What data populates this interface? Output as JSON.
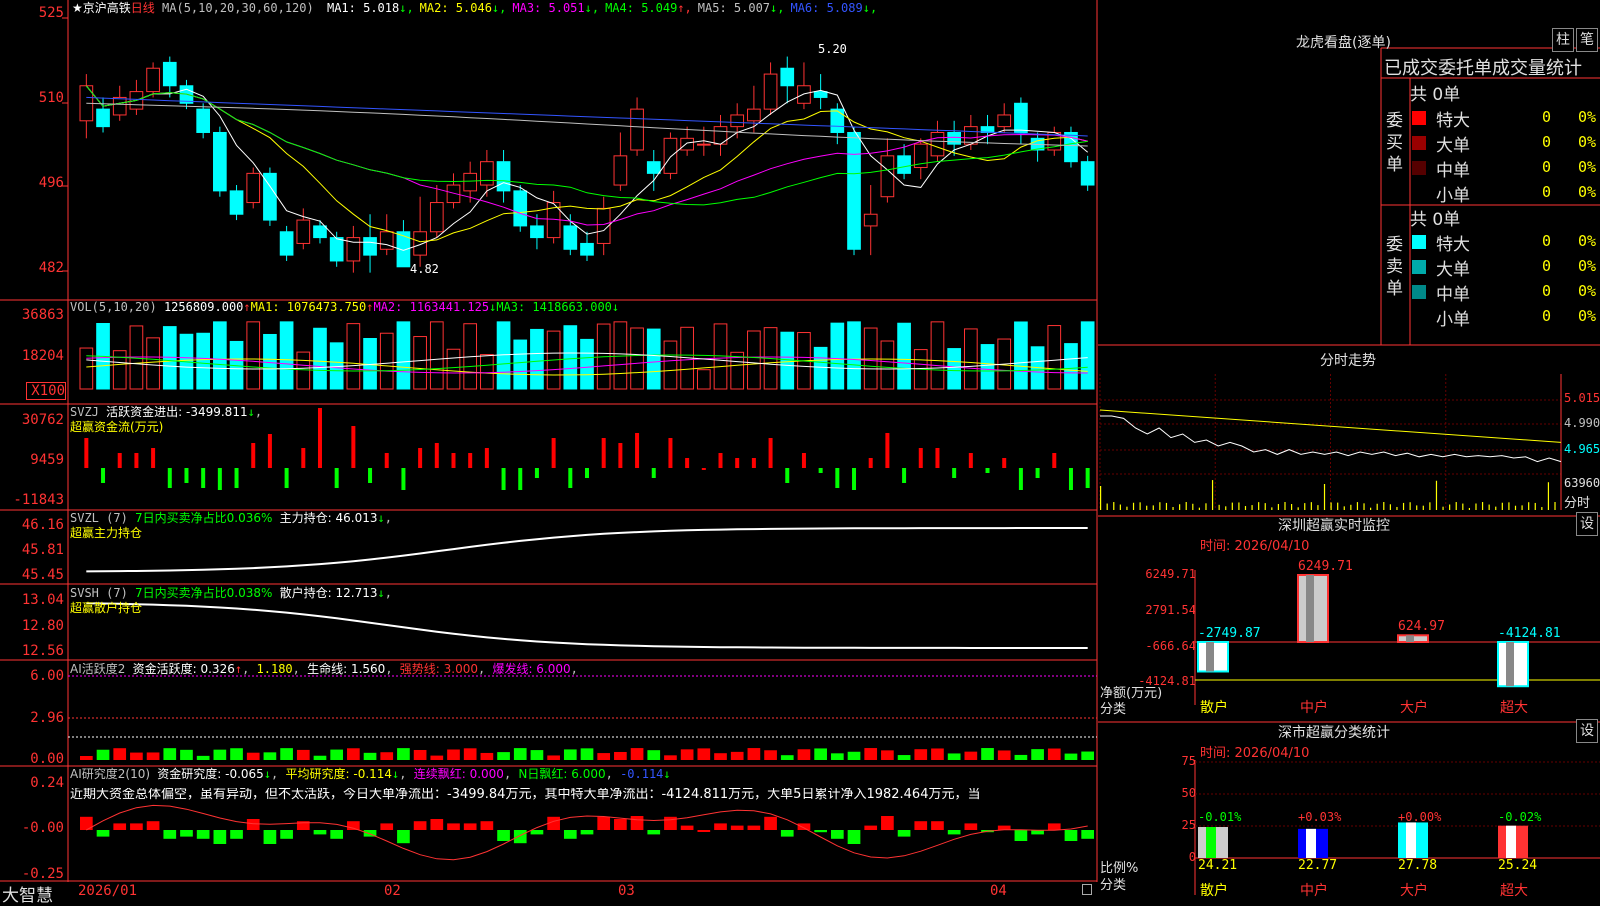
{
  "app": {
    "brand": "大智慧"
  },
  "header": {
    "stock_name": "★京沪高铁",
    "period": "日线",
    "ma_params": "MA(5,10,20,30,60,120)",
    "ma": [
      {
        "label": "MA1: 5.018",
        "arrow": "↓",
        "color": "#ffffff"
      },
      {
        "label": "MA2: 5.046",
        "arrow": "↓",
        "color": "#ffff00"
      },
      {
        "label": "MA3: 5.051",
        "arrow": "↓",
        "color": "#ff00ff"
      },
      {
        "label": "MA4: 5.049",
        "arrow": "↑",
        "color": "#00ff00"
      },
      {
        "label": "MA5: 5.007",
        "arrow": "↓",
        "color": "#c0c0c0"
      },
      {
        "label": "MA6: 5.089",
        "arrow": "↓",
        "color": "#3355ff"
      }
    ]
  },
  "price_panel": {
    "y_ticks": [
      "525",
      "510",
      "496",
      "482"
    ],
    "high_label": "5.20",
    "low_label": "4.82"
  },
  "vol_panel": {
    "title": "VOL(5,10,20)",
    "value": "1256809.000",
    "ma1": "MA1: 1076473.750",
    "ma2": "MA2: 1163441.125",
    "ma3": "MA3: 1418663.000",
    "y_ticks": [
      "36863",
      "18204"
    ],
    "unit": "X100"
  },
  "svzj_panel": {
    "title": "SVZJ",
    "line1": "活跃资金进出: -3499.811",
    "line2": "超赢资金流(万元)",
    "y_ticks": [
      "30762",
      "9459",
      "-11843"
    ]
  },
  "svzl_panel": {
    "title": "SVZL (7)",
    "desc": "7日内买卖净占比0.036%",
    "value": "主力持仓: 46.013",
    "line2": "超赢主力持仓",
    "y_ticks": [
      "46.16",
      "45.81",
      "45.45"
    ]
  },
  "svsh_panel": {
    "title": "SVSH (7)",
    "desc": "7日内买卖净占比0.038%",
    "value": "散户持仓: 12.713",
    "line2": "超赢散户持仓",
    "y_ticks": [
      "13.04",
      "12.80",
      "12.56"
    ]
  },
  "ai1_panel": {
    "title": "AI活跃度2",
    "v1": "资金活跃度: 0.326",
    "v2": "1.180",
    "v3": "生命线: 1.560",
    "v4": "强势线: 3.000",
    "v5": "爆发线: 6.000",
    "y_ticks": [
      "6.00",
      "2.96",
      "0.00"
    ]
  },
  "ai2_panel": {
    "title": "AI研究度2(10)",
    "v1": "资金研究度: -0.065",
    "v2": "平均研究度: -0.114",
    "v3": "连续飘红: 0.000",
    "v4": "N日飘红: 6.000",
    "v5": "-0.114",
    "summary": "近期大资金总体偏空，虽有异动，但不太活跃，今日大单净流出：-3499.84万元，其中特大单净流出：-4124.811万元，大单5日累计净入1982.464万元，当",
    "y_ticks": [
      "0.24",
      "-0.00",
      "-0.25"
    ]
  },
  "x_axis": {
    "labels": [
      "2026/01",
      "02",
      "03",
      "04"
    ]
  },
  "right": {
    "title": "龙虎看盘(逐单)",
    "btn1": "柱",
    "btn2": "笔",
    "tabs": "已成交委托单成交量统计",
    "buy_label": "委买单",
    "sell_label": "委卖单",
    "buy_total": "共 0单",
    "sell_total": "共 0单",
    "buy_rows": [
      {
        "name": "特大",
        "count": "0",
        "pct": "0%",
        "color": "#ff0000"
      },
      {
        "name": "大单",
        "count": "0",
        "pct": "0%",
        "color": "#990000"
      },
      {
        "name": "中单",
        "count": "0",
        "pct": "0%",
        "color": "#550000"
      },
      {
        "name": "小单",
        "count": "0",
        "pct": "0%",
        "color": ""
      }
    ],
    "sell_rows": [
      {
        "name": "特大",
        "count": "0",
        "pct": "0%",
        "color": "#00ffff"
      },
      {
        "name": "大单",
        "count": "0",
        "pct": "0%",
        "color": "#00aaaa"
      },
      {
        "name": "中单",
        "count": "0",
        "pct": "0%",
        "color": "#008888"
      },
      {
        "name": "小单",
        "count": "0",
        "pct": "0%",
        "color": ""
      }
    ],
    "minute": {
      "title": "分时走势",
      "ticks": [
        "5.015",
        "4.990",
        "4.965"
      ],
      "vol": "63960",
      "label": "分时"
    },
    "monitor": {
      "title": "深圳超赢实时监控",
      "btn": "设",
      "time": "时间: 2026/04/10",
      "y_ticks": [
        "6249.71",
        "2791.54",
        "-666.64",
        "-4124.81"
      ],
      "unit_label": "净额(万元)",
      "cat_label": "分类",
      "categories": [
        "散户",
        "中户",
        "大户",
        "超大"
      ],
      "values_text": [
        "-2749.87",
        "6249.71",
        "624.97",
        "-4124.81"
      ]
    },
    "classify": {
      "title": "深市超赢分类统计",
      "btn": "设",
      "time": "时间: 2026/04/10",
      "y_ticks": [
        "75",
        "50",
        "25",
        "0"
      ],
      "ratio_label": "比例%",
      "cat_label": "分类",
      "categories": [
        "散户",
        "中户",
        "大户",
        "超大"
      ],
      "values": [
        "24.21",
        "22.77",
        "27.78",
        "25.24"
      ],
      "changes": [
        "-0.01%",
        "+0.03%",
        "+0.00%",
        "-0.02%"
      ]
    }
  },
  "chart_data": [
    {
      "type": "candlestick",
      "title": "京沪高铁 日线",
      "ylim": [
        4.78,
        5.28
      ],
      "candles": [
        [
          5.08,
          5.14,
          5.16,
          5.05
        ],
        [
          5.1,
          5.07,
          5.12,
          5.06
        ],
        [
          5.09,
          5.12,
          5.14,
          5.08
        ],
        [
          5.1,
          5.13,
          5.15,
          5.09
        ],
        [
          5.13,
          5.17,
          5.18,
          5.12
        ],
        [
          5.18,
          5.14,
          5.19,
          5.12
        ],
        [
          5.14,
          5.11,
          5.15,
          5.1
        ],
        [
          5.1,
          5.06,
          5.11,
          5.05
        ],
        [
          5.06,
          4.96,
          5.07,
          4.95
        ],
        [
          4.96,
          4.92,
          4.97,
          4.91
        ],
        [
          4.94,
          4.99,
          5.0,
          4.93
        ],
        [
          4.99,
          4.91,
          5.0,
          4.9
        ],
        [
          4.89,
          4.85,
          4.9,
          4.84
        ],
        [
          4.87,
          4.91,
          4.93,
          4.86
        ],
        [
          4.9,
          4.88,
          4.91,
          4.87
        ],
        [
          4.88,
          4.84,
          4.89,
          4.83
        ],
        [
          4.84,
          4.88,
          4.9,
          4.82
        ],
        [
          4.88,
          4.85,
          4.92,
          4.82
        ],
        [
          4.86,
          4.89,
          4.92,
          4.85
        ],
        [
          4.89,
          4.83,
          4.91,
          4.83
        ],
        [
          4.85,
          4.89,
          4.95,
          4.83
        ],
        [
          4.89,
          4.94,
          4.97,
          4.88
        ],
        [
          4.94,
          4.97,
          4.99,
          4.93
        ],
        [
          4.96,
          4.99,
          5.01,
          4.94
        ],
        [
          4.97,
          5.01,
          5.03,
          4.95
        ],
        [
          5.01,
          4.96,
          5.03,
          4.94
        ],
        [
          4.96,
          4.9,
          4.97,
          4.89
        ],
        [
          4.9,
          4.88,
          4.92,
          4.86
        ],
        [
          4.88,
          4.94,
          4.96,
          4.87
        ],
        [
          4.9,
          4.86,
          4.92,
          4.85
        ],
        [
          4.87,
          4.85,
          4.89,
          4.84
        ],
        [
          4.87,
          4.93,
          4.95,
          4.85
        ],
        [
          4.97,
          5.02,
          5.06,
          4.96
        ],
        [
          5.03,
          5.1,
          5.12,
          5.02
        ],
        [
          5.01,
          4.99,
          5.03,
          4.96
        ],
        [
          4.99,
          5.05,
          5.06,
          4.98
        ],
        [
          5.03,
          5.05,
          5.07,
          5.02
        ],
        [
          5.04,
          5.04,
          5.07,
          5.02
        ],
        [
          5.04,
          5.07,
          5.09,
          5.02
        ],
        [
          5.07,
          5.09,
          5.11,
          5.05
        ],
        [
          5.08,
          5.1,
          5.14,
          5.06
        ],
        [
          5.1,
          5.16,
          5.18,
          5.09
        ],
        [
          5.17,
          5.14,
          5.19,
          5.11
        ],
        [
          5.11,
          5.14,
          5.18,
          5.1
        ],
        [
          5.13,
          5.12,
          5.16,
          5.1
        ],
        [
          5.1,
          5.06,
          5.11,
          5.04
        ],
        [
          5.06,
          4.86,
          5.07,
          4.85
        ],
        [
          4.9,
          4.92,
          4.97,
          4.85
        ],
        [
          4.95,
          5.02,
          5.05,
          4.94
        ],
        [
          5.02,
          4.99,
          5.04,
          4.98
        ],
        [
          5.0,
          5.04,
          5.05,
          4.98
        ],
        [
          5.02,
          5.06,
          5.08,
          5.01
        ],
        [
          5.06,
          5.04,
          5.08,
          5.02
        ],
        [
          5.04,
          5.07,
          5.09,
          5.03
        ],
        [
          5.07,
          5.06,
          5.09,
          5.04
        ],
        [
          5.07,
          5.09,
          5.11,
          5.06
        ],
        [
          5.11,
          5.06,
          5.12,
          5.04
        ],
        [
          5.05,
          5.03,
          5.06,
          5.01
        ],
        [
          5.03,
          5.06,
          5.07,
          5.02
        ],
        [
          5.06,
          5.01,
          5.07,
          5.0
        ],
        [
          5.01,
          4.97,
          5.02,
          4.96
        ]
      ]
    },
    {
      "type": "bar",
      "title": "深圳超赢实时监控",
      "ylabel": "净额(万元)",
      "categories": [
        "散户",
        "中户",
        "大户",
        "超大"
      ],
      "values": [
        -2749.87,
        6249.71,
        624.97,
        -4124.81
      ],
      "ylim": [
        -4124.81,
        6249.71
      ]
    },
    {
      "type": "bar",
      "title": "深市超赢分类统计",
      "ylabel": "比例%",
      "categories": [
        "散户",
        "中户",
        "大户",
        "超大"
      ],
      "values": [
        24.21,
        22.77,
        27.78,
        25.24
      ],
      "ylim": [
        0,
        75
      ]
    },
    {
      "type": "line",
      "title": "分时走势",
      "ylim": [
        4.955,
        5.02
      ],
      "values": [
        5.0,
        5.0,
        4.998,
        4.99,
        4.985,
        4.99,
        4.982,
        4.985,
        4.978,
        4.98,
        4.975,
        4.978,
        4.975,
        4.97,
        4.972,
        4.968,
        4.972,
        4.968,
        4.97,
        4.968,
        4.97,
        4.967,
        4.97,
        4.968,
        4.97,
        4.967,
        4.969,
        4.966,
        4.968,
        4.966,
        4.968,
        4.966,
        4.967,
        4.966,
        4.967,
        4.965,
        4.966,
        4.962,
        4.965,
        4.962
      ]
    }
  ]
}
